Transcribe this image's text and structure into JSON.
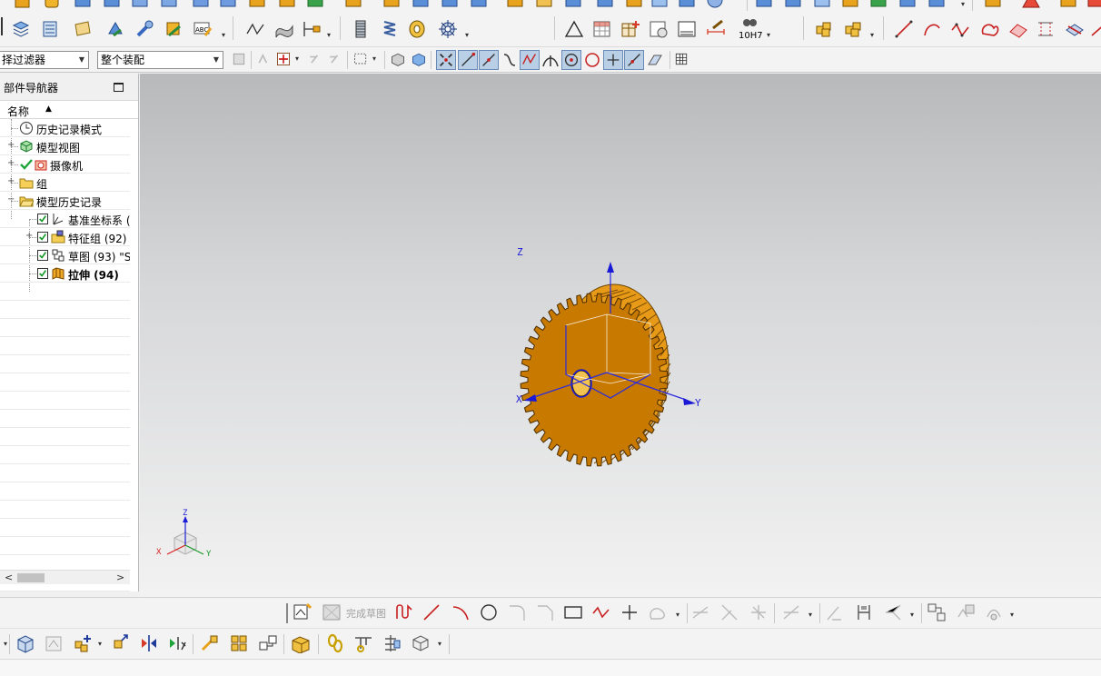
{
  "toolbar": {
    "selection_filter": "择过滤器",
    "assembly_scope": "整个装配",
    "tolerance_label": "10H7"
  },
  "navigator": {
    "title": "部件导航器",
    "column_name": "名称",
    "items": [
      {
        "label": "历史记录模式",
        "icon": "clock-icon"
      },
      {
        "label": "模型视图",
        "icon": "model-views-icon"
      },
      {
        "label": "摄像机",
        "icon": "camera-icon"
      },
      {
        "label": "组",
        "icon": "folder-icon"
      },
      {
        "label": "模型历史记录",
        "icon": "folder-open-icon"
      },
      {
        "label": "基准坐标系 (",
        "icon": "datum-csys-icon"
      },
      {
        "label": "特征组 (92)",
        "icon": "feature-group-icon"
      },
      {
        "label": "草图 (93) \"S",
        "icon": "sketch-icon"
      },
      {
        "label": "拉伸 (94)",
        "icon": "extrude-icon"
      }
    ]
  },
  "viewport": {
    "axis_x": "X",
    "axis_y": "Y",
    "axis_z": "Z",
    "triad_x": "X",
    "triad_y": "Y",
    "triad_z": "Z",
    "gear_color": "#c87a00",
    "highlight_color": "#1a1ad6"
  },
  "sketch_toolbar": {
    "finish_sketch": "完成草图"
  }
}
